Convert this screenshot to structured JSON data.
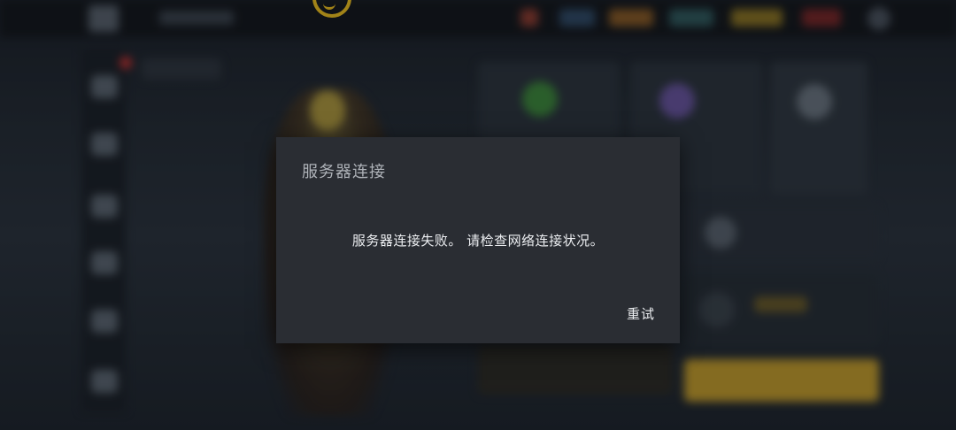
{
  "dialog": {
    "title": "服务器连接",
    "message": "服务器连接失败。 请检查网络连接状况。",
    "retry_label": "重试"
  },
  "background": {
    "accent_color": "#f3c31d",
    "notification_color": "#c8312e",
    "primary_button_color": "#c79f2a",
    "sidebar_icons": [
      "menu-icon",
      "profile-icon",
      "inventory-icon",
      "shop-icon",
      "chat-icon",
      "settings-icon"
    ],
    "top_bar_icons": [
      "friends-icon",
      "logo-icon",
      "currency-icon",
      "currency-icon",
      "currency-icon",
      "currency-icon",
      "currency-icon",
      "settings-icon"
    ]
  }
}
